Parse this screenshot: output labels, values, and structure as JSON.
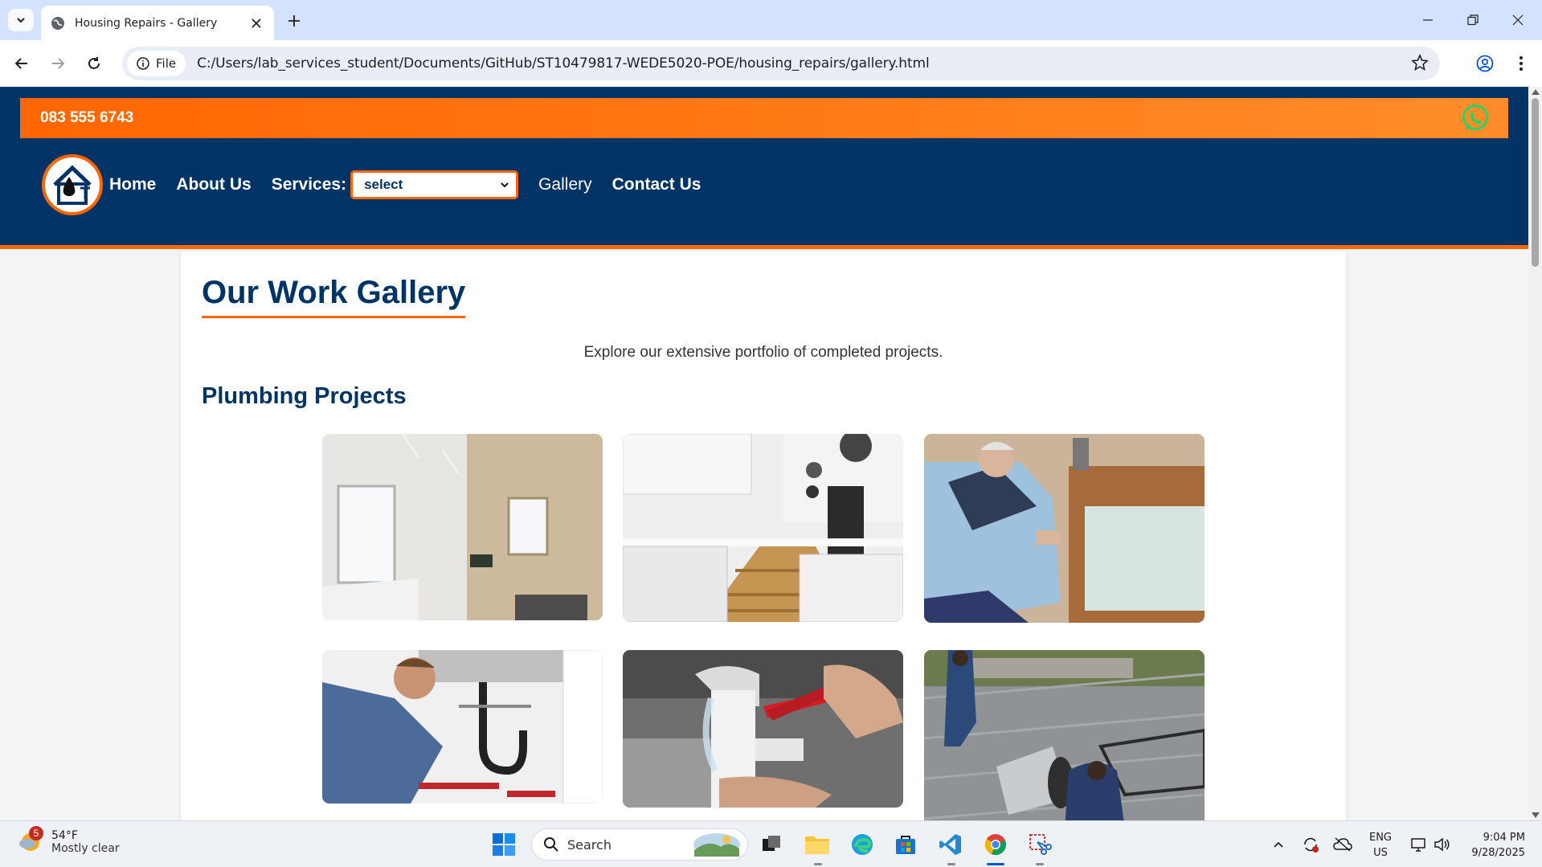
{
  "browser": {
    "tab_title": "Housing Repairs - Gallery",
    "site_chip": "File",
    "url": "C:/Users/lab_services_student/Documents/GitHub/ST10479817-WEDE5020-POE/housing_repairs/gallery.html"
  },
  "site": {
    "phone": "083 555 6743",
    "nav": {
      "home": "Home",
      "about": "About Us",
      "services_label": "Services:",
      "services_selected": "select",
      "gallery": "Gallery",
      "contact": "Contact Us"
    },
    "colors": {
      "primary": "#003366",
      "accent": "#ff6600",
      "whatsapp": "#25d366"
    }
  },
  "main": {
    "title": "Our Work Gallery",
    "intro": "Explore our extensive portfolio of completed projects.",
    "section_title": "Plumbing Projects",
    "gallery_items": [
      "bathroom-photo",
      "kitchen-photo",
      "plumber-under-sink-photo",
      "plumber-pipes-photo",
      "pipe-wrench-photo",
      "roof-geyser-photo"
    ]
  },
  "taskbar": {
    "weather_badge": "5",
    "temperature": "54°F",
    "condition": "Mostly clear",
    "search_placeholder": "Search",
    "lang_top": "ENG",
    "lang_bottom": "US",
    "time": "9:04 PM",
    "date": "9/28/2025"
  }
}
